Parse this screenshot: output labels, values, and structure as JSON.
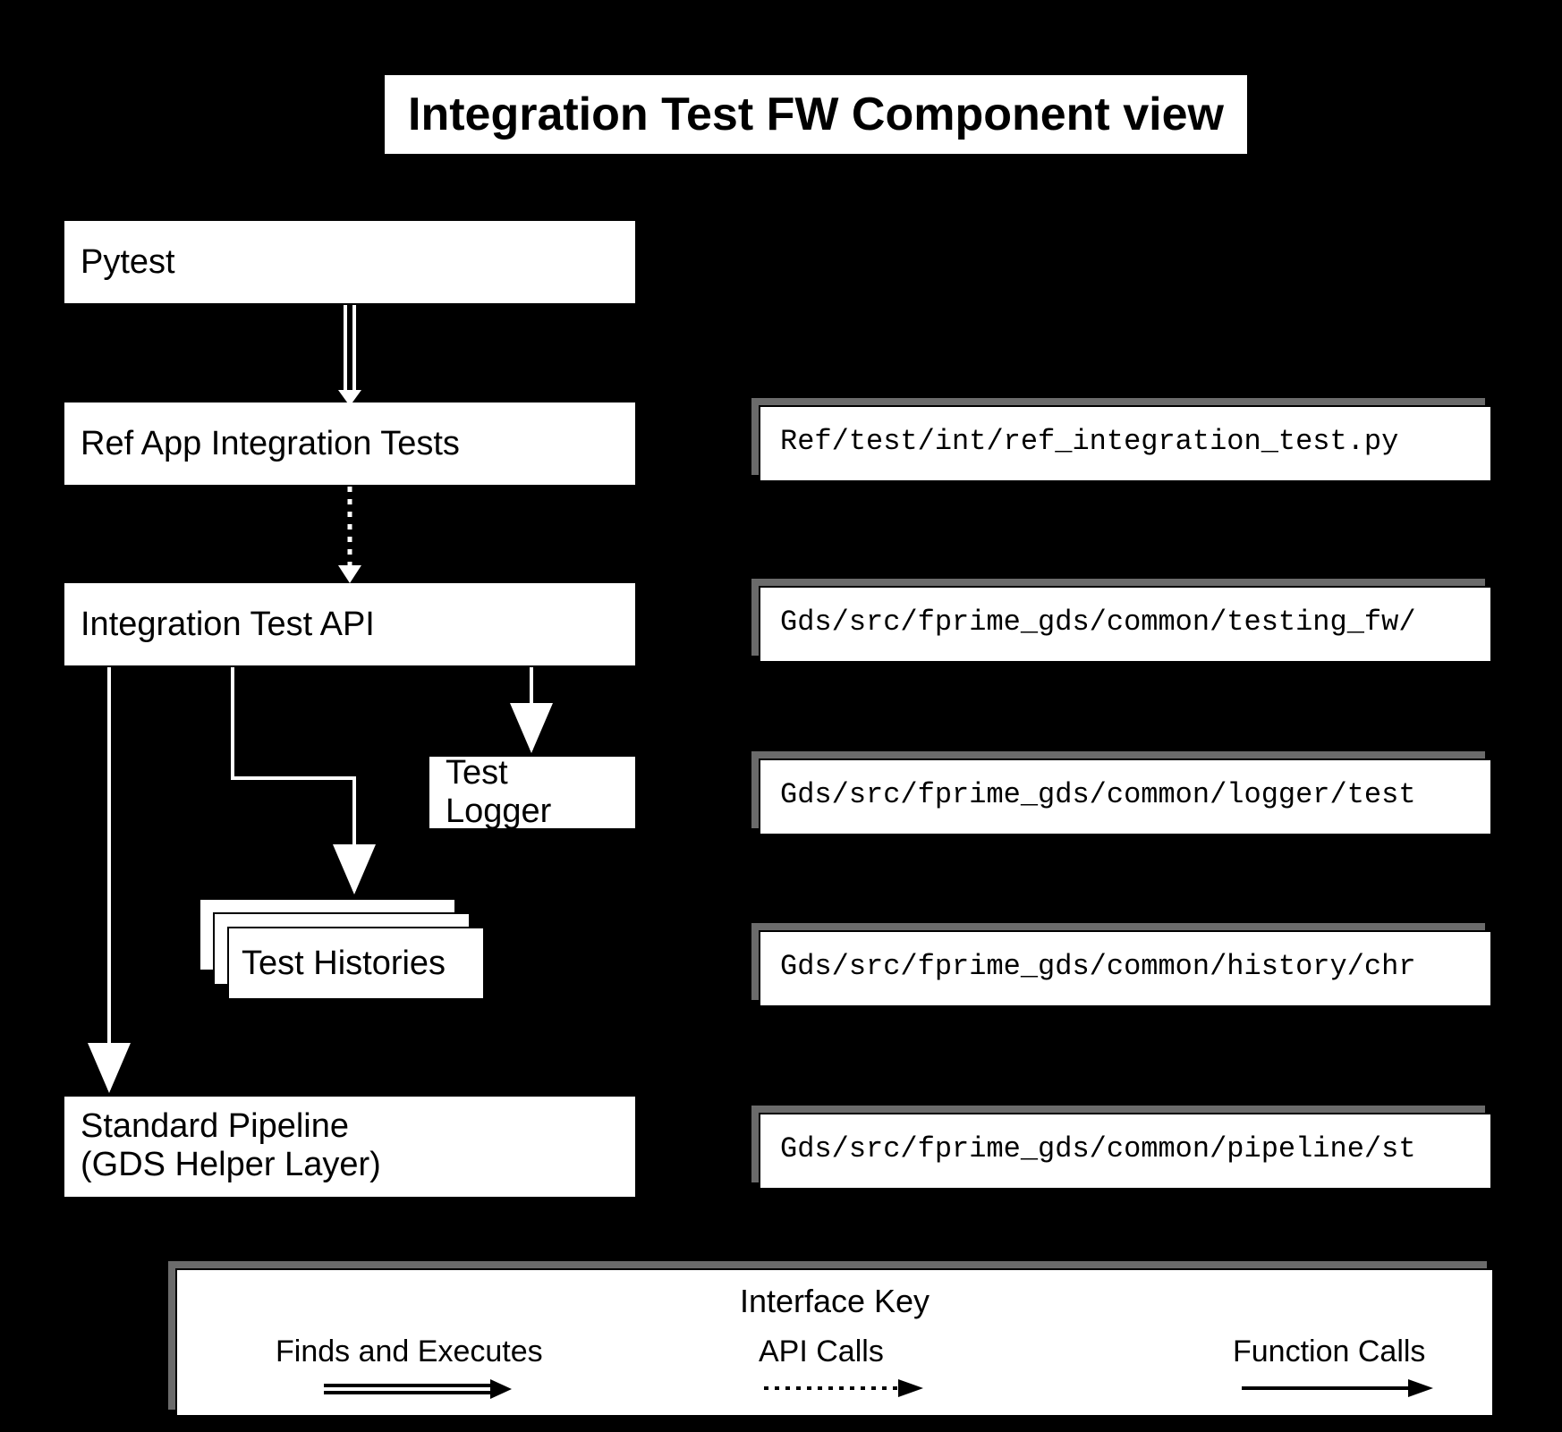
{
  "title": "Integration Test FW Component view",
  "components": {
    "pytest": "Pytest",
    "ref_app": "Ref App Integration Tests",
    "api": "Integration Test API",
    "logger": "Test Logger",
    "histories": "Test Histories",
    "pipeline_line1": "Standard Pipeline",
    "pipeline_line2": "(GDS Helper Layer)"
  },
  "paths": {
    "ref_app": "Ref/test/int/ref_integration_test.py",
    "api": "Gds/src/fprime_gds/common/testing_fw/",
    "logger": "Gds/src/fprime_gds/common/logger/test",
    "histories": "Gds/src/fprime_gds/common/history/chr",
    "pipeline": "Gds/src/fprime_gds/common/pipeline/st"
  },
  "key": {
    "title": "Interface Key",
    "finds": "Finds and Executes",
    "api_calls": "API Calls",
    "func_calls": "Function Calls"
  }
}
